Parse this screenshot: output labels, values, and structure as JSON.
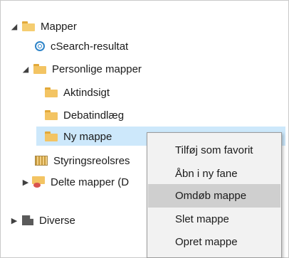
{
  "tree": {
    "items": [
      {
        "label": "Mapper",
        "icon": "folder-open-icon"
      },
      {
        "label": "cSearch-resultat",
        "icon": "search-icon"
      },
      {
        "label": "Personlige mapper",
        "icon": "folder-icon"
      },
      {
        "label": "Aktindsigt",
        "icon": "folder-icon"
      },
      {
        "label": "Debatindlæg",
        "icon": "folder-icon"
      },
      {
        "label": "Ny mappe",
        "icon": "folder-icon",
        "selected": true
      },
      {
        "label": "Styringsreolsres",
        "icon": "stack-icon"
      },
      {
        "label": "Delte mapper (D",
        "icon": "shared-folder-icon"
      },
      {
        "label": "Diverse",
        "icon": "misc-icon"
      }
    ]
  },
  "context_menu": {
    "items": [
      {
        "label": "Tilføj som favorit"
      },
      {
        "label": "Åbn i ny fane"
      },
      {
        "label": "Omdøb mappe",
        "highlighted": true
      },
      {
        "label": "Slet mappe"
      },
      {
        "label": "Opret mappe"
      }
    ]
  },
  "colors": {
    "selection": "#cde8fb",
    "menu_background": "#f2f2f2",
    "menu_highlight": "#cfcfcf",
    "folder": "#f3c463"
  }
}
